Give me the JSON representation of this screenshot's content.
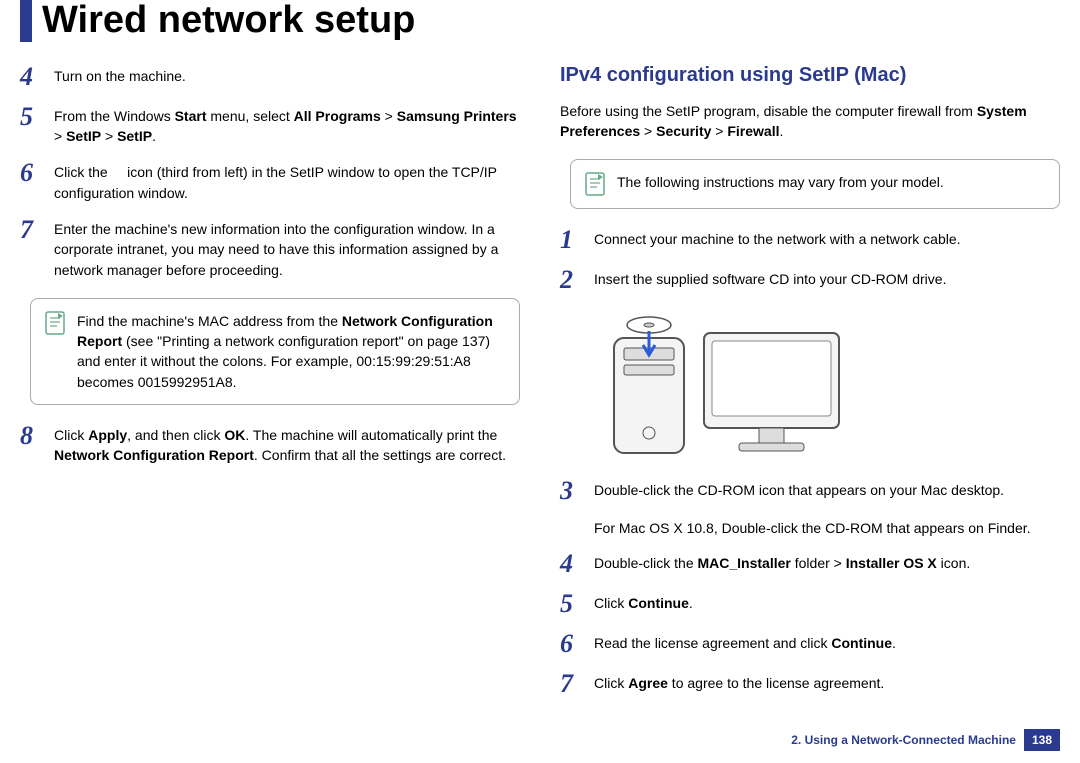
{
  "title": "Wired network setup",
  "left": {
    "steps": [
      {
        "num": "4",
        "html": "Turn on the machine."
      },
      {
        "num": "5",
        "html": "From the Windows <b>Start</b> menu, select <b>All Programs</b> > <b>Samsung Printers</b> > <b>SetIP</b> > <b>SetIP</b>."
      },
      {
        "num": "6",
        "html": "Click the &nbsp;&nbsp;&nbsp; icon (third from left) in the SetIP window to open the TCP/IP configuration window."
      },
      {
        "num": "7",
        "html": "Enter the machine's new information into the configuration window. In a corporate intranet, you may need to have this information assigned by a network manager before proceeding."
      }
    ],
    "note": "Find the machine's MAC address from the <b>Network Configuration Report</b> (see \"Printing a network configuration report\" on page 137) and enter it without the colons. For example, 00:15:99:29:51:A8 becomes 0015992951A8.",
    "steps2": [
      {
        "num": "8",
        "html": "Click <b>Apply</b>, and then click <b>OK</b>. The machine will automatically print the <b>Network Configuration Report</b>. Confirm that all the settings are correct."
      }
    ]
  },
  "right": {
    "heading": "IPv4 configuration using SetIP (Mac)",
    "intro": "Before using the SetIP program, disable the computer firewall from <b>System Preferences</b> > <b>Security</b> > <b>Firewall</b>.",
    "note": "The following instructions may vary from your model.",
    "steps": [
      {
        "num": "1",
        "html": "Connect your machine to the network with a network cable."
      },
      {
        "num": "2",
        "html": "Insert the supplied software CD into your CD-ROM drive."
      }
    ],
    "step3": {
      "num": "3",
      "html": "Double-click the CD-ROM icon that appears on your Mac desktop."
    },
    "sub3": "For Mac OS X 10.8, Double-click the CD-ROM that appears on Finder.",
    "steps_after": [
      {
        "num": "4",
        "html": "Double-click the <b>MAC_Installer</b> folder > <b>Installer OS X</b> icon."
      },
      {
        "num": "5",
        "html": "Click <b>Continue</b>."
      },
      {
        "num": "6",
        "html": "Read the license agreement and click <b>Continue</b>."
      },
      {
        "num": "7",
        "html": "Click <b>Agree</b> to agree to the license agreement."
      }
    ]
  },
  "footer": {
    "chapter": "2.  Using a Network-Connected Machine",
    "page": "138"
  }
}
